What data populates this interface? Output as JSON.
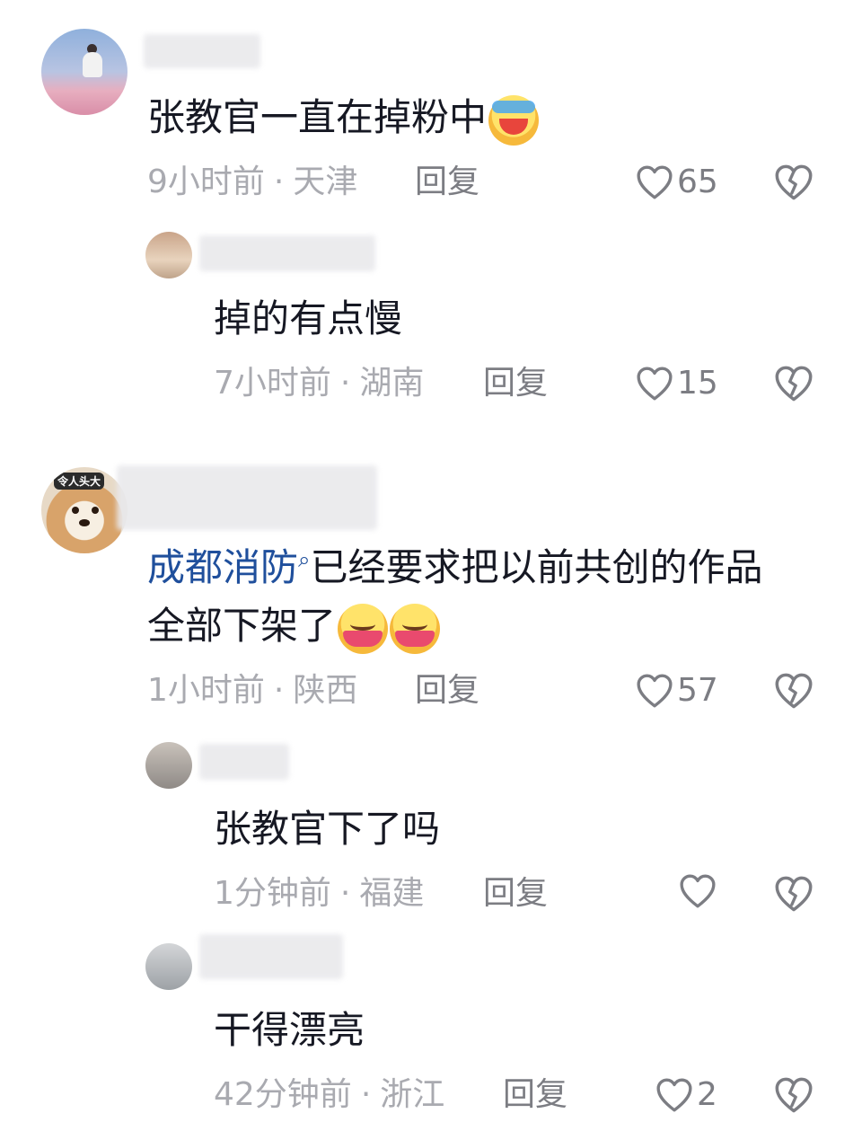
{
  "comments": [
    {
      "text": "张教官一直在掉粉中",
      "time": "9小时前",
      "location": "天津",
      "reply_label": "回复",
      "likes": "65",
      "emoji": "laughing-crying-emoji"
    },
    {
      "text": "掉的有点慢",
      "time": "7小时前",
      "location": "湖南",
      "reply_label": "回复",
      "likes": "15"
    },
    {
      "mention": "成都消防",
      "text_line1": "已经要求把以前共创的作品",
      "text_line2": "全部下架了",
      "time": "1小时前",
      "location": "陕西",
      "reply_label": "回复",
      "likes": "57",
      "avatar_tag": "令人头大",
      "emoji": "eating-noodles-emoji"
    },
    {
      "text": "张教官下了吗",
      "time": "1分钟前",
      "location": "福建",
      "reply_label": "回复",
      "likes": ""
    },
    {
      "text": "干得漂亮",
      "time": "42分钟前",
      "location": "浙江",
      "reply_label": "回复",
      "likes": "2"
    }
  ],
  "separator": "·",
  "icons": {
    "like": "heart-outline-icon",
    "dislike": "broken-heart-icon"
  },
  "colors": {
    "mention": "#1f4f9c",
    "meta": "#a9aab0",
    "text": "#161823"
  }
}
